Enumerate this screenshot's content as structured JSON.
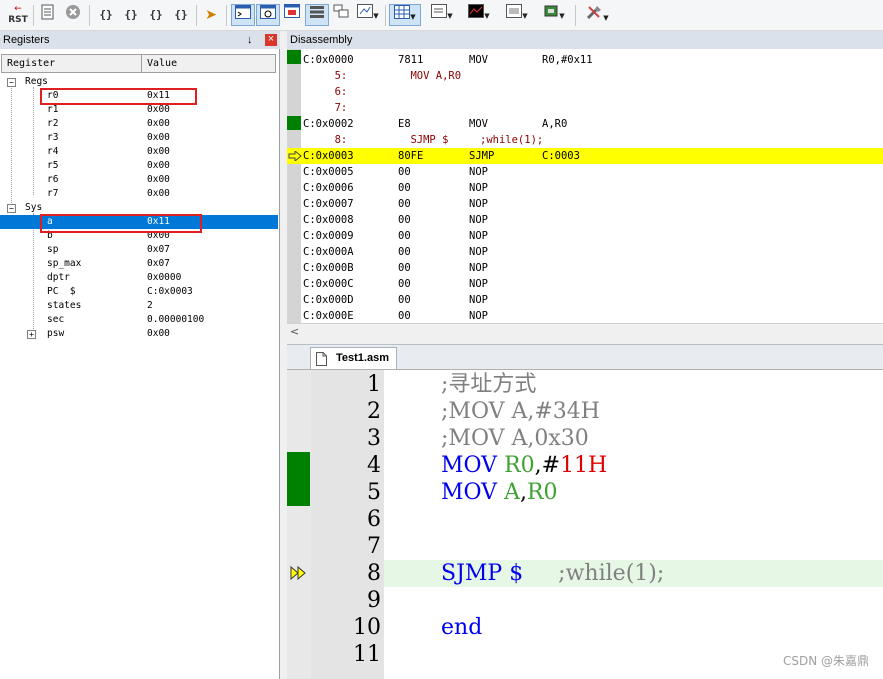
{
  "toolbar": {
    "rst_label": "RST",
    "brace_buttons": [
      "{}",
      "{}",
      "{}",
      "{}"
    ]
  },
  "registers": {
    "title": "Registers",
    "pin_glyph": "↓",
    "close_glyph": "×",
    "col_register": "Register",
    "col_value": "Value",
    "groups": [
      {
        "name": "Regs",
        "items": [
          {
            "name": "r0",
            "value": "0x11"
          },
          {
            "name": "r1",
            "value": "0x00"
          },
          {
            "name": "r2",
            "value": "0x00"
          },
          {
            "name": "r3",
            "value": "0x00"
          },
          {
            "name": "r4",
            "value": "0x00"
          },
          {
            "name": "r5",
            "value": "0x00"
          },
          {
            "name": "r6",
            "value": "0x00"
          },
          {
            "name": "r7",
            "value": "0x00"
          }
        ]
      },
      {
        "name": "Sys",
        "items": [
          {
            "name": "a",
            "value": "0x11"
          },
          {
            "name": "b",
            "value": "0x00"
          },
          {
            "name": "sp",
            "value": "0x07"
          },
          {
            "name": "sp_max",
            "value": "0x07"
          },
          {
            "name": "dptr",
            "value": "0x0000"
          },
          {
            "name": "PC  $",
            "value": "C:0x0003"
          },
          {
            "name": "states",
            "value": "2"
          },
          {
            "name": "sec",
            "value": "0.00000100"
          },
          {
            "name": "psw",
            "value": "0x00"
          }
        ]
      }
    ]
  },
  "disassembly": {
    "title": "Disassembly",
    "rows": [
      {
        "addr": "C:0x0000",
        "op": "7811",
        "mn": "MOV",
        "arg": "R0,#0x11",
        "type": "code"
      },
      {
        "src": "     5:          MOV A,R0",
        "type": "src"
      },
      {
        "src": "     6:",
        "type": "src"
      },
      {
        "src": "     7:",
        "type": "src"
      },
      {
        "addr": "C:0x0002",
        "op": "E8",
        "mn": "MOV",
        "arg": "A,R0",
        "type": "code"
      },
      {
        "src": "     8:          SJMP $     ;while(1);",
        "type": "src"
      },
      {
        "addr": "C:0x0003",
        "op": "80FE",
        "mn": "SJMP",
        "arg": "C:0003",
        "type": "current"
      },
      {
        "addr": "C:0x0005",
        "op": "00",
        "mn": "NOP",
        "arg": "",
        "type": "code"
      },
      {
        "addr": "C:0x0006",
        "op": "00",
        "mn": "NOP",
        "arg": "",
        "type": "code"
      },
      {
        "addr": "C:0x0007",
        "op": "00",
        "mn": "NOP",
        "arg": "",
        "type": "code"
      },
      {
        "addr": "C:0x0008",
        "op": "00",
        "mn": "NOP",
        "arg": "",
        "type": "code"
      },
      {
        "addr": "C:0x0009",
        "op": "00",
        "mn": "NOP",
        "arg": "",
        "type": "code"
      },
      {
        "addr": "C:0x000A",
        "op": "00",
        "mn": "NOP",
        "arg": "",
        "type": "code"
      },
      {
        "addr": "C:0x000B",
        "op": "00",
        "mn": "NOP",
        "arg": "",
        "type": "code"
      },
      {
        "addr": "C:0x000C",
        "op": "00",
        "mn": "NOP",
        "arg": "",
        "type": "code"
      },
      {
        "addr": "C:0x000D",
        "op": "00",
        "mn": "NOP",
        "arg": "",
        "type": "code"
      },
      {
        "addr": "C:0x000E",
        "op": "00",
        "mn": "NOP",
        "arg": "",
        "type": "code"
      }
    ],
    "scroll_left_glyph": "<"
  },
  "editor": {
    "tab_label": "Test1.asm",
    "line_numbers": [
      "1",
      "2",
      "3",
      "4",
      "5",
      "6",
      "7",
      "8",
      "9",
      "10",
      "11"
    ],
    "lines": [
      [
        {
          "t": ";寻址方式",
          "c": "cm"
        }
      ],
      [
        {
          "t": ";MOV A,#34H",
          "c": "cm"
        }
      ],
      [
        {
          "t": ";MOV A,0x30",
          "c": "cm"
        }
      ],
      [
        {
          "t": "MOV ",
          "c": "kw"
        },
        {
          "t": "R0",
          "c": "rg"
        },
        {
          "t": ",#",
          "c": "pl"
        },
        {
          "t": "11H",
          "c": "num"
        }
      ],
      [
        {
          "t": "MOV ",
          "c": "kw"
        },
        {
          "t": "A",
          "c": "rg"
        },
        {
          "t": ",",
          "c": "pl"
        },
        {
          "t": "R0",
          "c": "rg"
        }
      ],
      [],
      [],
      [
        {
          "t": "SJMP $",
          "c": "kw"
        },
        {
          "t": "     ;while(1);",
          "c": "cm"
        }
      ],
      [],
      [
        {
          "t": "end",
          "c": "kw"
        }
      ],
      []
    ]
  },
  "watermark": "CSDN @朱嘉鼎",
  "colors": {
    "current_line": "#ffff00",
    "breakpoint_green": "#008000",
    "selection": "#0078d7",
    "highlight_box": "#e02020"
  }
}
